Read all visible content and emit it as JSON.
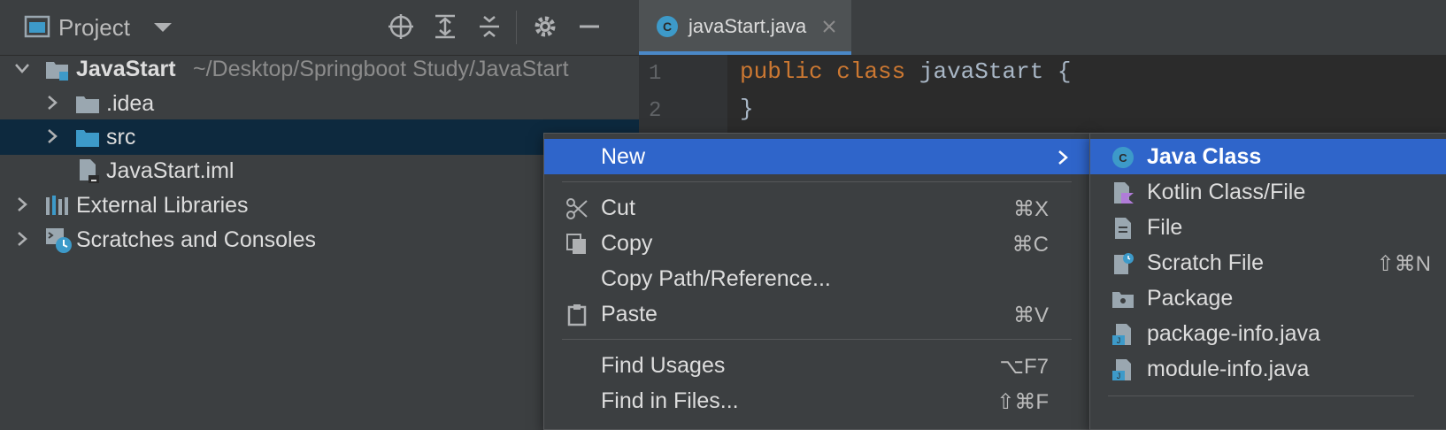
{
  "project": {
    "title": "Project",
    "tree": {
      "root_name": "JavaStart",
      "root_path": "~/Desktop/Springboot Study/JavaStart",
      "idea": ".idea",
      "src": "src",
      "iml": "JavaStart.iml",
      "external_libraries": "External Libraries",
      "scratches": "Scratches and Consoles"
    }
  },
  "editor": {
    "tab_label": "javaStart.java",
    "line_numbers": [
      "1",
      "2"
    ],
    "code": {
      "kw_public": "public",
      "kw_class": "class",
      "class_name": "javaStart",
      "open_brace": "{",
      "close_brace": "}"
    }
  },
  "context_menu": {
    "new": "New",
    "cut": "Cut",
    "cut_shortcut": "⌘X",
    "copy": "Copy",
    "copy_shortcut": "⌘C",
    "copy_path": "Copy Path/Reference...",
    "paste": "Paste",
    "paste_shortcut": "⌘V",
    "find_usages": "Find Usages",
    "find_usages_shortcut": "⌥F7",
    "find_in_files": "Find in Files...",
    "find_in_files_shortcut": "⇧⌘F"
  },
  "submenu": {
    "java_class": "Java Class",
    "kotlin": "Kotlin Class/File",
    "file": "File",
    "scratch_file": "Scratch File",
    "scratch_shortcut": "⇧⌘N",
    "package": "Package",
    "package_info": "package-info.java",
    "module_info": "module-info.java"
  },
  "colors": {
    "selection": "#2f65ca",
    "tree_selection": "#0d293e",
    "accent_folder": "#3d9ac9",
    "keyword": "#cc7832"
  }
}
